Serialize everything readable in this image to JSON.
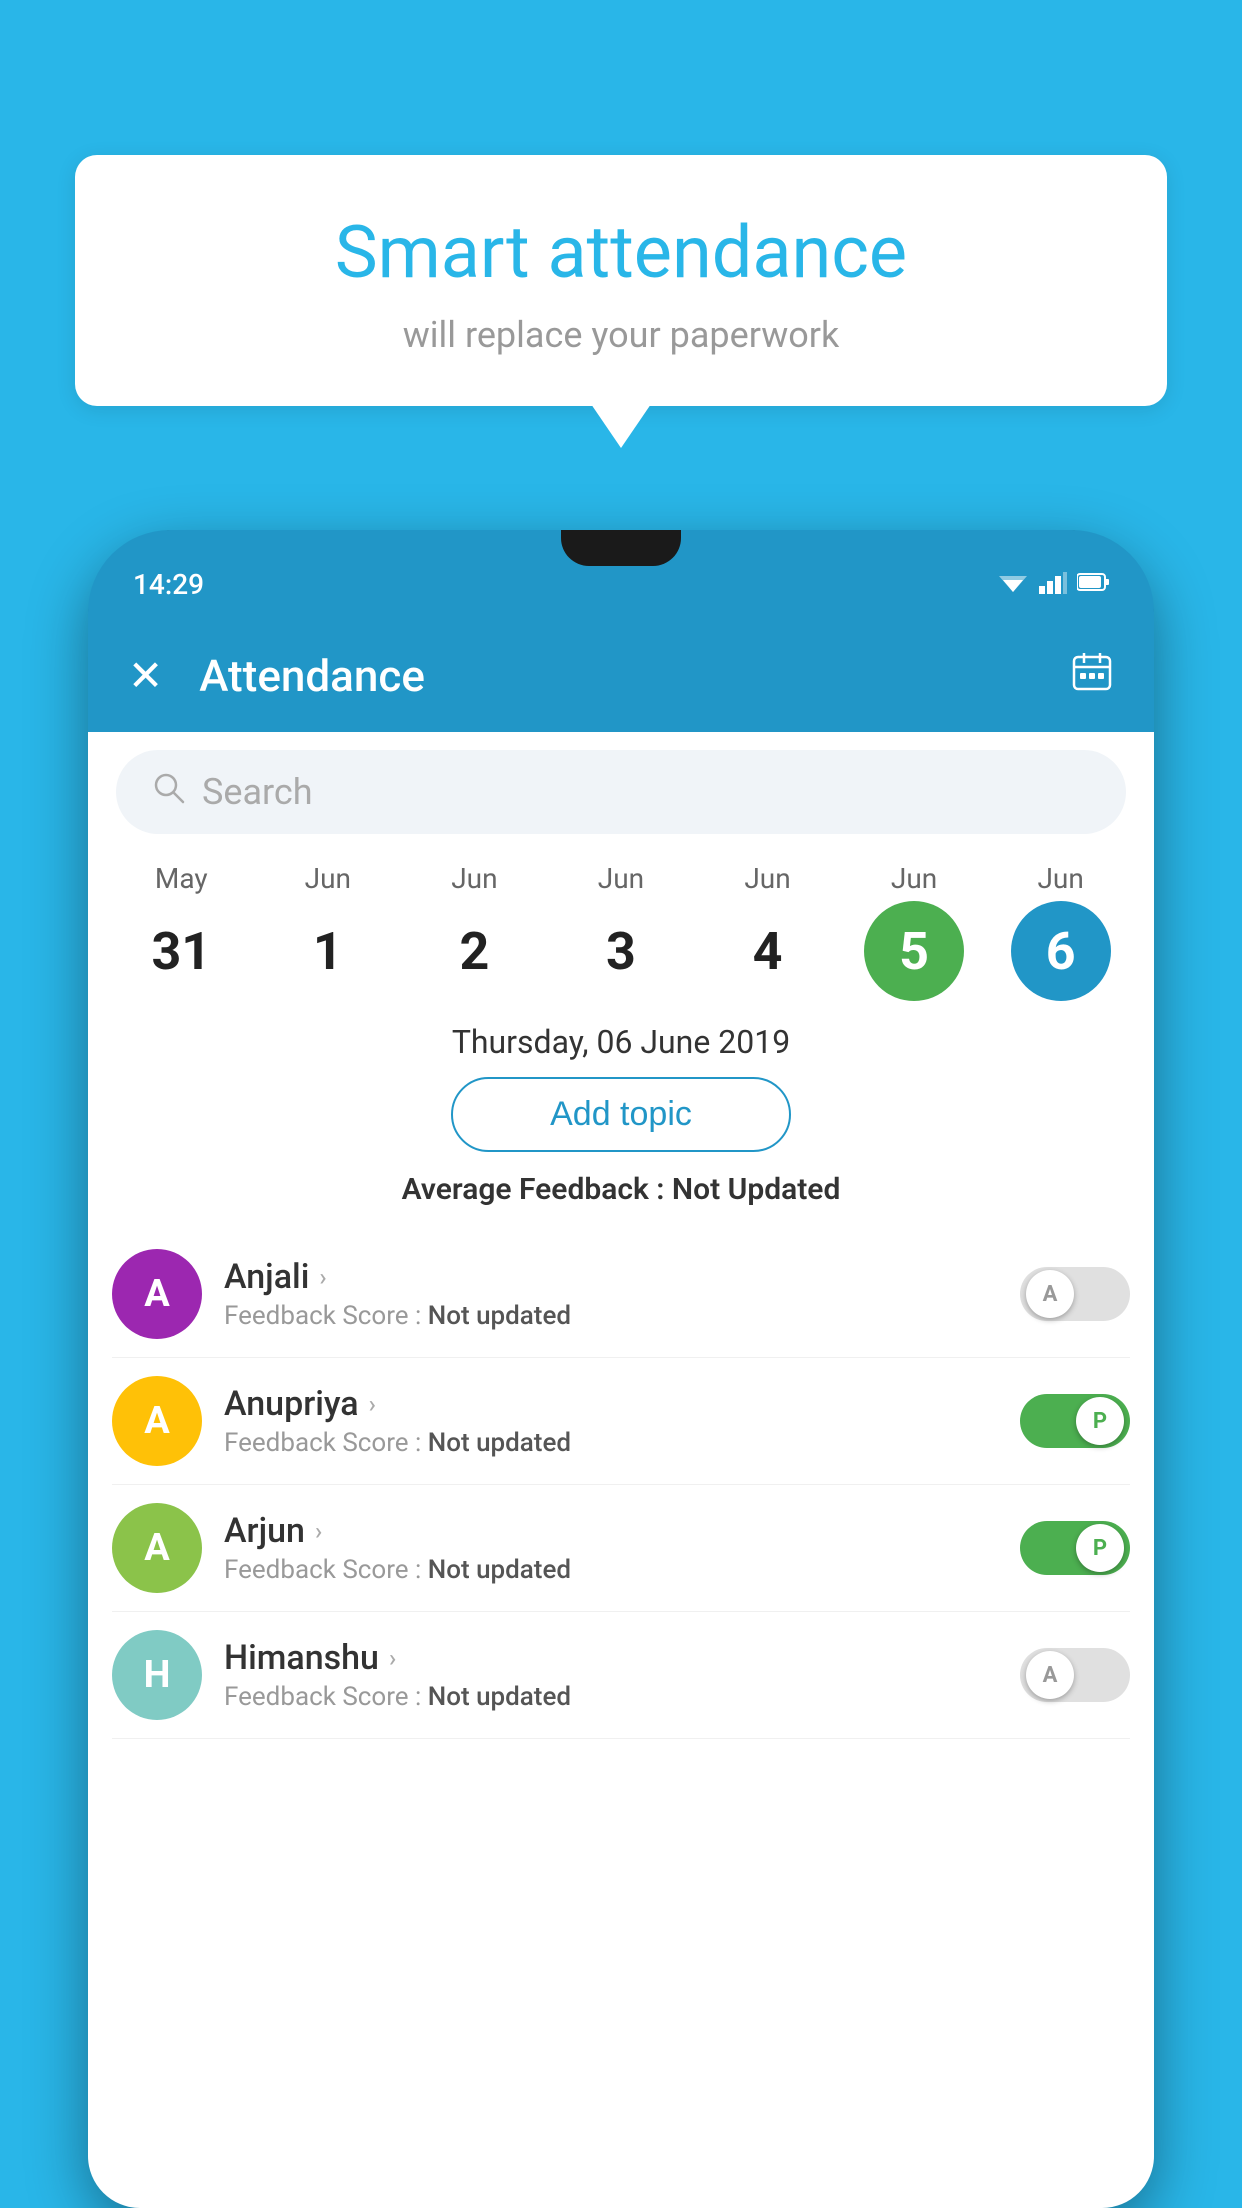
{
  "background_color": "#29b6e8",
  "bubble": {
    "title": "Smart attendance",
    "subtitle": "will replace your paperwork"
  },
  "status_bar": {
    "time": "14:29",
    "wifi_icon": "▼",
    "signal_icon": "▲",
    "battery_icon": "▮"
  },
  "app_bar": {
    "title": "Attendance",
    "close_icon": "✕",
    "calendar_icon": "📅"
  },
  "search": {
    "placeholder": "Search"
  },
  "calendar": {
    "days": [
      {
        "month": "May",
        "date": "31",
        "style": "normal"
      },
      {
        "month": "Jun",
        "date": "1",
        "style": "normal"
      },
      {
        "month": "Jun",
        "date": "2",
        "style": "normal"
      },
      {
        "month": "Jun",
        "date": "3",
        "style": "normal"
      },
      {
        "month": "Jun",
        "date": "4",
        "style": "normal"
      },
      {
        "month": "Jun",
        "date": "5",
        "style": "green"
      },
      {
        "month": "Jun",
        "date": "6",
        "style": "blue"
      }
    ]
  },
  "selected_date": "Thursday, 06 June 2019",
  "add_topic_label": "Add topic",
  "avg_feedback": {
    "label": "Average Feedback : ",
    "value": "Not Updated"
  },
  "students": [
    {
      "name": "Anjali",
      "avatar_letter": "A",
      "avatar_color": "purple",
      "feedback_label": "Feedback Score : ",
      "feedback_value": "Not updated",
      "attendance": "A",
      "toggle_state": "off"
    },
    {
      "name": "Anupriya",
      "avatar_letter": "A",
      "avatar_color": "yellow",
      "feedback_label": "Feedback Score : ",
      "feedback_value": "Not updated",
      "attendance": "P",
      "toggle_state": "on"
    },
    {
      "name": "Arjun",
      "avatar_letter": "A",
      "avatar_color": "light-green",
      "feedback_label": "Feedback Score : ",
      "feedback_value": "Not updated",
      "attendance": "P",
      "toggle_state": "on"
    },
    {
      "name": "Himanshu",
      "avatar_letter": "H",
      "avatar_color": "teal",
      "feedback_label": "Feedback Score : ",
      "feedback_value": "Not updated",
      "attendance": "A",
      "toggle_state": "off"
    }
  ]
}
